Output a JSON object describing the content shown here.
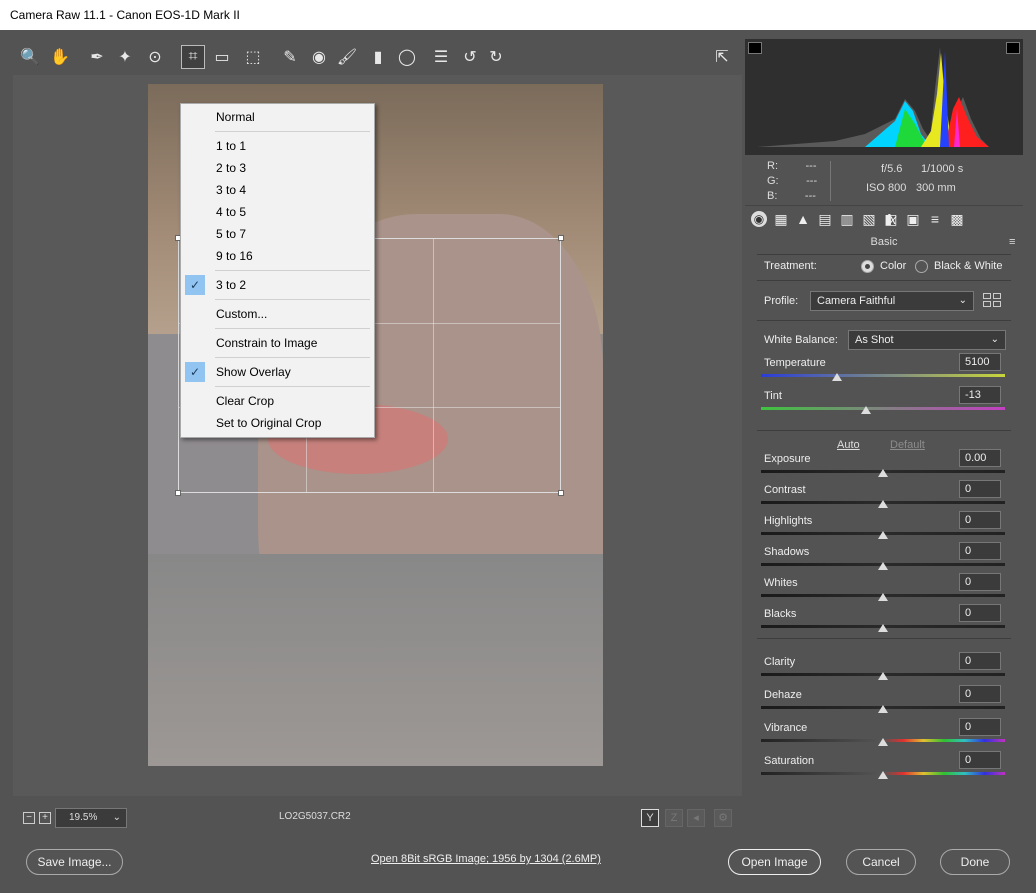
{
  "window": {
    "title": "Camera Raw 11.1  -  Canon EOS-1D Mark II"
  },
  "toolbar": {
    "tools": [
      {
        "name": "zoom-tool-icon",
        "glyph": "🔍"
      },
      {
        "name": "hand-tool-icon",
        "glyph": "✋"
      },
      {
        "name": "white-balance-tool-icon",
        "glyph": "✒"
      },
      {
        "name": "color-sampler-tool-icon",
        "glyph": "✦"
      },
      {
        "name": "targeted-adjustment-tool-icon",
        "glyph": "⊙"
      },
      {
        "name": "crop-tool-icon",
        "glyph": "⌗"
      },
      {
        "name": "straighten-tool-icon",
        "glyph": "▭"
      },
      {
        "name": "transform-tool-icon",
        "glyph": "⬚"
      },
      {
        "name": "spot-removal-tool-icon",
        "glyph": "✎"
      },
      {
        "name": "red-eye-tool-icon",
        "glyph": "◉"
      },
      {
        "name": "adjustment-brush-icon",
        "glyph": "🖌"
      },
      {
        "name": "graduated-filter-icon",
        "glyph": "▮"
      },
      {
        "name": "radial-filter-icon",
        "glyph": "◯"
      },
      {
        "name": "preferences-icon",
        "glyph": "☰"
      },
      {
        "name": "rotate-left-icon",
        "glyph": "↺"
      },
      {
        "name": "rotate-right-icon",
        "glyph": "↻"
      }
    ],
    "export_icon": "⇱"
  },
  "crop_menu": {
    "items": [
      {
        "label": "Normal",
        "checked": false
      },
      {
        "label": "1 to 1",
        "checked": false
      },
      {
        "label": "2 to 3",
        "checked": false
      },
      {
        "label": "3 to 4",
        "checked": false
      },
      {
        "label": "4 to 5",
        "checked": false
      },
      {
        "label": "5 to 7",
        "checked": false
      },
      {
        "label": "9 to 16",
        "checked": false
      },
      {
        "label": "3 to 2",
        "checked": true
      },
      {
        "label": "Custom...",
        "checked": false
      },
      {
        "label": "Constrain to Image",
        "checked": false
      },
      {
        "label": "Show Overlay",
        "checked": true
      },
      {
        "label": "Clear Crop",
        "checked": false
      },
      {
        "label": "Set to Original Crop",
        "checked": false
      }
    ],
    "check_glyph": "✓"
  },
  "preview_bar": {
    "zoom_minus": "−",
    "zoom_plus": "+",
    "zoom_value": "19.5%",
    "zoom_chevron": "⌄",
    "filename": "LO2G5037.CR2",
    "view_y": "Y",
    "view_swap": "Z",
    "view_copy": "◂",
    "view_settings": "⚙"
  },
  "info": {
    "r_label": "R:",
    "r_value": "---",
    "g_label": "G:",
    "g_value": "---",
    "b_label": "B:",
    "b_value": "---",
    "aperture": "f/5.6",
    "shutter": "1/1000 s",
    "iso": "ISO 800",
    "focal": "300 mm"
  },
  "panel": {
    "tab_glyphs": [
      "◉",
      "▦",
      "▲",
      "▤",
      "▥",
      "▧",
      "◧",
      "fx",
      "▣",
      "≡",
      "▩"
    ],
    "title": "Basic",
    "menu_glyph": "≡",
    "treatment_label": "Treatment:",
    "treatment_color": "Color",
    "treatment_bw": "Black & White",
    "profile_label": "Profile:",
    "profile_value": "Camera Faithful",
    "white_balance_label": "White Balance:",
    "white_balance_value": "As Shot",
    "auto_label": "Auto",
    "default_label": "Default",
    "sliders": [
      {
        "key": "temperature",
        "label": "Temperature",
        "value": "5100",
        "position": 0.31
      },
      {
        "key": "tint",
        "label": "Tint",
        "value": "-13",
        "position": 0.43
      },
      {
        "key": "exposure",
        "label": "Exposure",
        "value": "0.00",
        "position": 0.5
      },
      {
        "key": "contrast",
        "label": "Contrast",
        "value": "0",
        "position": 0.5
      },
      {
        "key": "highlights",
        "label": "Highlights",
        "value": "0",
        "position": 0.5
      },
      {
        "key": "shadows",
        "label": "Shadows",
        "value": "0",
        "position": 0.5
      },
      {
        "key": "whites",
        "label": "Whites",
        "value": "0",
        "position": 0.5
      },
      {
        "key": "blacks",
        "label": "Blacks",
        "value": "0",
        "position": 0.5
      },
      {
        "key": "clarity",
        "label": "Clarity",
        "value": "0",
        "position": 0.5
      },
      {
        "key": "dehaze",
        "label": "Dehaze",
        "value": "0",
        "position": 0.5
      },
      {
        "key": "vibrance",
        "label": "Vibrance",
        "value": "0",
        "position": 0.5
      },
      {
        "key": "saturation",
        "label": "Saturation",
        "value": "0",
        "position": 0.5
      }
    ]
  },
  "footer": {
    "save_image": "Save Image...",
    "workflow_link": "Open 8Bit sRGB Image; 1956 by 1304 (2.6MP)",
    "open_image": "Open Image",
    "cancel": "Cancel",
    "done": "Done"
  }
}
